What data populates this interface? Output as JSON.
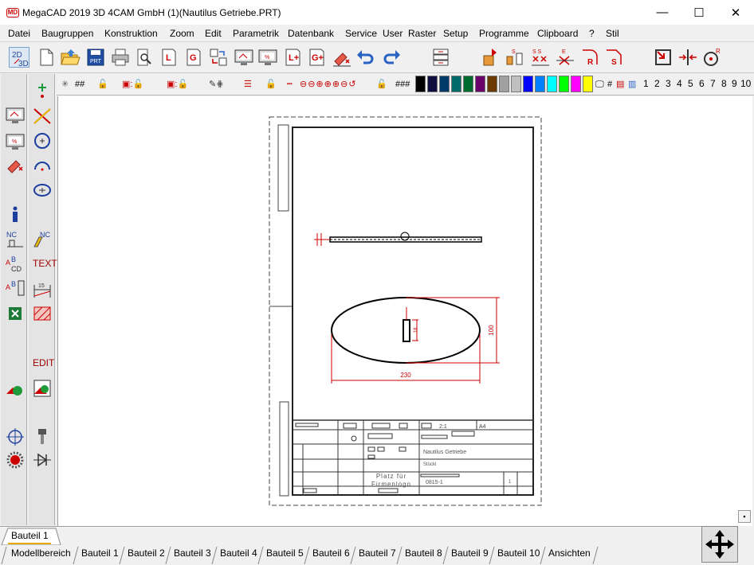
{
  "window": {
    "title": "MegaCAD 2019 3D 4CAM GmbH (1)(Nautilus Getriebe.PRT)",
    "minimize": "—",
    "maximize": "☐",
    "close": "✕",
    "logo_text": "MD"
  },
  "menu": [
    "Datei",
    "Baugruppen",
    "Konstruktion",
    "Zoom",
    "Edit",
    "Parametrik",
    "Datenbank",
    "Service",
    "User",
    "Raster",
    "Setup",
    "Programme",
    "Clipboard",
    "?",
    "Stil"
  ],
  "toolbar2": {
    "hash_labels": [
      "##",
      "###"
    ],
    "layer_numbers": [
      "1",
      "2",
      "3",
      "4",
      "5",
      "6",
      "7",
      "8",
      "9",
      "10"
    ],
    "colors": [
      "#000000",
      "#0f0f3f",
      "#003a6a",
      "#006b6b",
      "#006b2e",
      "#6a006a",
      "#6a3a00",
      "#a0a0a0",
      "#c0c0c0",
      "#0000ff",
      "#0080ff",
      "#00ffff",
      "#00ff00",
      "#ff00ff",
      "#ffff00",
      "#ffffff"
    ]
  },
  "sidebar": {
    "text_label": "TEXT",
    "edit_label": "EDIT",
    "nc_label": "NC",
    "abcd_label": "ABCD"
  },
  "drawing": {
    "dim_width": "230",
    "dim_height": "100",
    "small_dim": "18",
    "title_scale": "2:1",
    "title_format": "A4",
    "part_name": "Nautilus Getriebe",
    "part_type": "Stückl",
    "logo_line1": "Platz für",
    "logo_line2": "Firmenlogo",
    "drawing_no": "0815-1",
    "sheet": "1"
  },
  "tabs_top": [
    "Bauteil 1"
  ],
  "tabs_bottom": [
    "Modellbereich",
    "Bauteil 1",
    "Bauteil 2",
    "Bauteil 3",
    "Bauteil 4",
    "Bauteil 5",
    "Bauteil 6",
    "Bauteil 7",
    "Bauteil 8",
    "Bauteil 9",
    "Bauteil 10",
    "Ansichten"
  ],
  "scroll_button": "▪"
}
